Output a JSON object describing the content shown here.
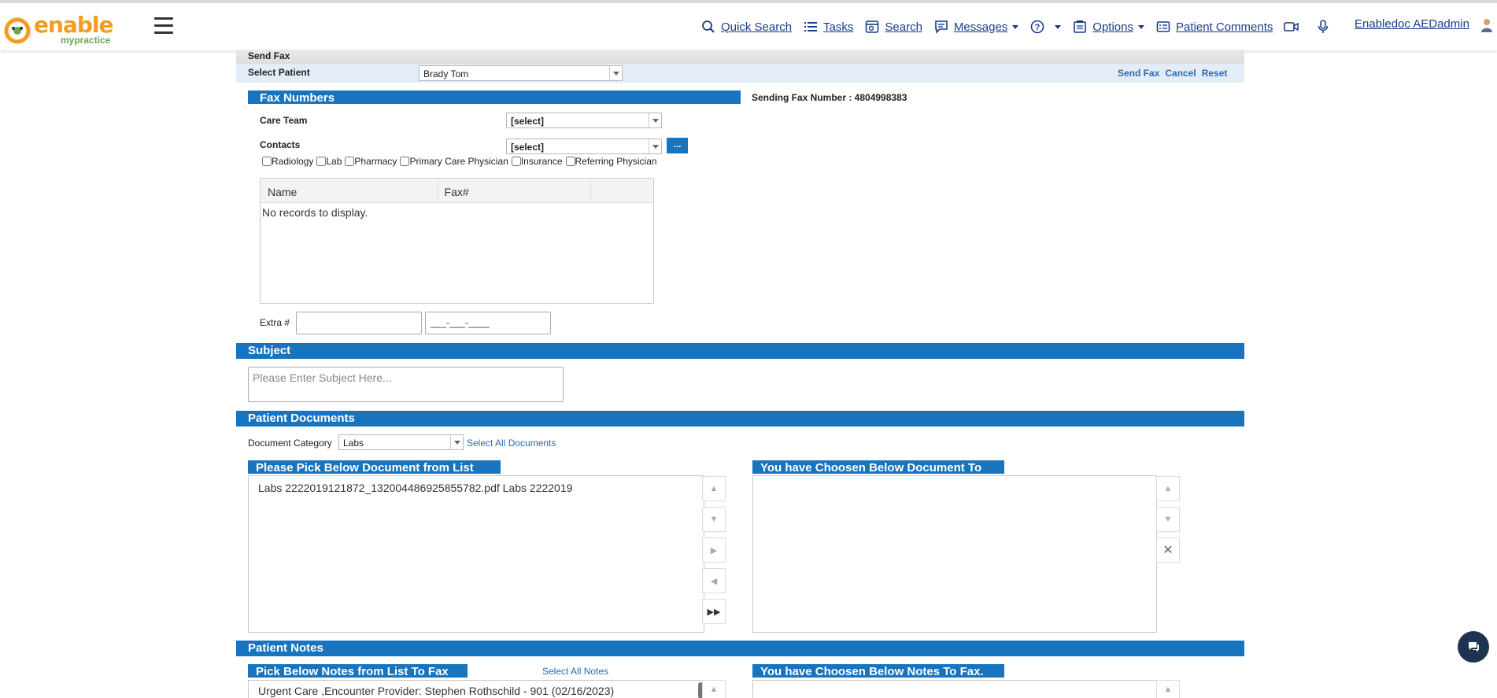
{
  "header": {
    "brand": "enable",
    "brand_sub": "mypractice",
    "nav": [
      {
        "label": "Quick Search",
        "icon": "search-icon"
      },
      {
        "label": "Tasks",
        "icon": "list-icon"
      },
      {
        "label": "Search",
        "icon": "search-doc-icon"
      },
      {
        "label": "Messages",
        "icon": "message-icon"
      },
      {
        "label": "Options",
        "icon": "options-icon"
      },
      {
        "label": "Patient Comments",
        "icon": "comments-icon"
      }
    ],
    "user": "Enabledoc AEDadmin"
  },
  "send_fax": {
    "title": "Send Fax",
    "select_patient_label": "Select Patient",
    "patient_value": "Brady Tom",
    "actions": {
      "send": "Send Fax",
      "cancel": "Cancel",
      "reset": "Reset"
    }
  },
  "fax_numbers": {
    "title": "Fax Numbers",
    "sending_fax": "Sending Fax Number : 4804998383",
    "care_team_label": "Care Team",
    "care_team_value": "[select]",
    "contacts_label": "Contacts",
    "contacts_value": "[select]",
    "more_button": "...",
    "checkboxes": [
      "Radiology",
      "Lab",
      "Pharmacy",
      "Primary Care Physician",
      "Insurance",
      "Referring Physician"
    ],
    "grid_columns": [
      "Name",
      "Fax#"
    ],
    "grid_empty": "No records to display.",
    "extra_label": "Extra #",
    "extra_mask": "___-___-____"
  },
  "subject": {
    "title": "Subject",
    "placeholder": "Please Enter Subject Here..."
  },
  "documents": {
    "title": "Patient Documents",
    "category_label": "Document Category",
    "category_value": "Labs",
    "select_all": "Select All Documents",
    "pick_title": "Please Pick Below Document from List",
    "chosen_title": "You have Choosen Below Document To",
    "items": [
      "Labs 2222019121872_132004486925855782.pdf Labs 2222019"
    ]
  },
  "notes": {
    "title": "Patient Notes",
    "pick_title": "Pick Below Notes from List To Fax",
    "select_all": "Select All Notes",
    "chosen_title": "You have Choosen Below Notes To Fax.",
    "items": [
      "Urgent Care ,Encounter Provider: Stephen Rothschild - 901 (02/16/2023)"
    ]
  }
}
